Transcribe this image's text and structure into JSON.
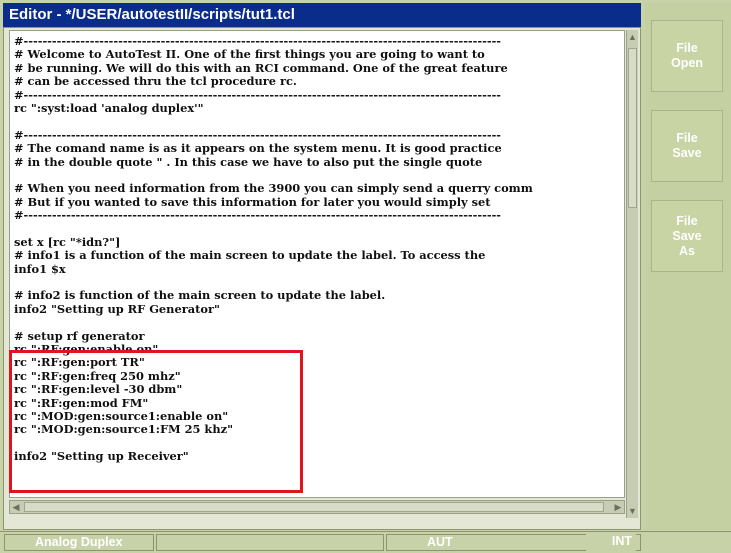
{
  "window": {
    "title": "Editor - */USER/autotestII/scripts/tut1.tcl"
  },
  "editor": {
    "lines": [
      "#-----------------------------------------------------------------------------------------------------",
      "# Welcome to AutoTest II. One of the first things you are going to want to",
      "# be running. We will do this with an RCI command. One of the great feature",
      "# can be accessed thru the tcl procedure rc.",
      "#-----------------------------------------------------------------------------------------------------",
      "rc \":syst:load 'analog duplex'\"",
      "",
      "#-----------------------------------------------------------------------------------------------------",
      "# The comand name is as it appears on the system menu. It is good practice",
      "# in the double quote \" . In this case we have to also put the single quote",
      "",
      "# When you need information from the 3900 you can simply send a querry comm",
      "# But if you wanted to save this information for later you would simply set",
      "#-----------------------------------------------------------------------------------------------------",
      "",
      "set x [rc \"*idn?\"]",
      "# info1 is a function of the main screen to update the label. To access the",
      "info1 $x",
      "",
      "# info2 is function of the main screen to update the label.",
      "info2 \"Setting up RF Generator\"",
      "",
      "# setup rf generator",
      "rc \":RF:gen:enable on\"",
      "rc \":RF:gen:port TR\"",
      "rc \":RF:gen:freq 250 mhz\"",
      "rc \":RF:gen:level -30 dbm\"",
      "rc \":RF:gen:mod FM\"",
      "rc \":MOD:gen:source1:enable on\"",
      "rc \":MOD:gen:source1:FM 25 khz\"",
      "",
      "info2 \"Setting up Receiver\""
    ]
  },
  "softkeys": {
    "file_open": "File\nOpen",
    "file_save": "File\nSave",
    "file_save_as": "File\nSave\nAs"
  },
  "status": {
    "mode": "Analog Duplex",
    "blank": "",
    "aut": "AUT",
    "int": "INT"
  },
  "icons": {
    "scroll_up": "up-arrow-icon",
    "scroll_down": "down-arrow-icon",
    "scroll_left": "left-arrow-icon",
    "scroll_right": "right-arrow-icon"
  },
  "colors": {
    "titlebar": "#0a2d8c",
    "highlight": "#e0141e",
    "panel": "#c8d2a8"
  }
}
